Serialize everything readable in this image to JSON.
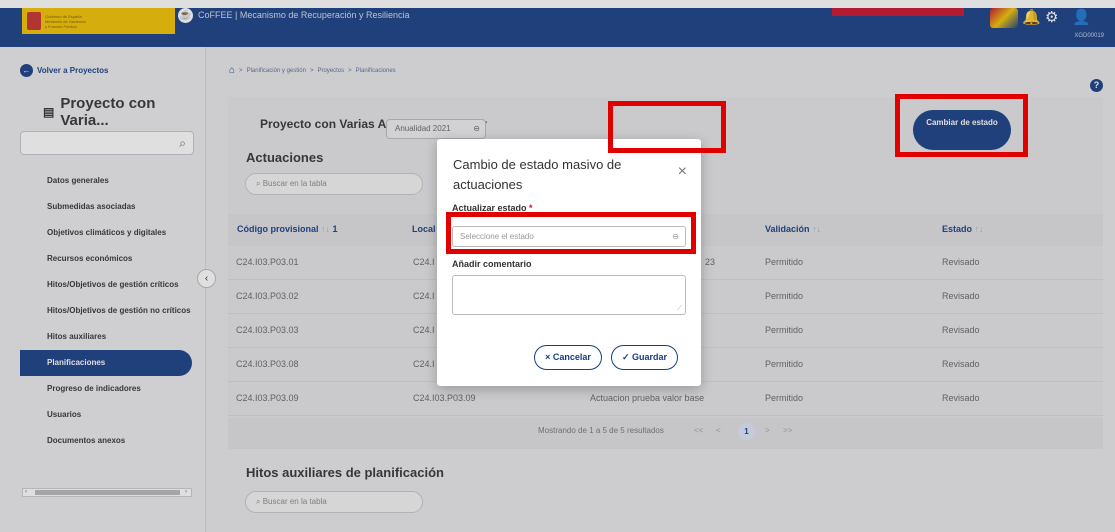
{
  "header": {
    "government_logo_text": [
      "Gobierno de España",
      "Ministerio de Hacienda",
      "y Función Pública"
    ],
    "app_prefix": "CoFFEE",
    "separator": "|",
    "app_title": "Mecanismo de Recuperación y Resiliencia",
    "user_code": "XGD00019",
    "icons": [
      "flag-logo-icon",
      "bell-icon",
      "gear-icon",
      "user-icon"
    ]
  },
  "sidebar": {
    "back_label": "Volver a Proyectos",
    "project_title": "Proyecto con Varia...",
    "search_placeholder": "",
    "items": [
      {
        "label": "Datos generales"
      },
      {
        "label": "Submedidas asociadas"
      },
      {
        "label": "Objetivos climáticos y digitales"
      },
      {
        "label": "Recursos económicos"
      },
      {
        "label": "Hitos/Objetivos de gestión críticos"
      },
      {
        "label": "Hitos/Objetivos de gestión no críticos"
      },
      {
        "label": "Hitos auxiliares"
      },
      {
        "label": "Planificaciones",
        "active": true
      },
      {
        "label": "Progreso de indicadores"
      },
      {
        "label": "Usuarios"
      },
      {
        "label": "Documentos anexos"
      }
    ]
  },
  "breadcrumb": {
    "items": [
      "Planificación y gestión",
      "Proyectos",
      "Planificaciones"
    ],
    "separator": ">"
  },
  "main": {
    "project_title": "Proyecto con Varias Actuaciones Rober",
    "annuality": "Anualidad 2021",
    "change_state_label": "Cambiar de estado",
    "actuaciones_title": "Actuaciones",
    "table_search_placeholder": "Buscar en la tabla",
    "table": {
      "headers": [
        "Código provisional",
        "Local",
        "Validación",
        "Estado"
      ],
      "sort_marker": "1",
      "rows": [
        [
          "C24.I03.P03.01",
          "C24.I",
          "23",
          "Permitido",
          "Revisado"
        ],
        [
          "C24.I03.P03.02",
          "C24.I",
          "",
          "Permitido",
          "Revisado"
        ],
        [
          "C24.I03.P03.03",
          "C24.I",
          "",
          "Permitido",
          "Revisado"
        ],
        [
          "C24.I03.P03.08",
          "C24.I",
          "",
          "Permitido",
          "Revisado"
        ],
        [
          "C24.I03.P03.09",
          "C24.I03.P03.09",
          "Actuacion prueba valor base",
          "Permitido",
          "Revisado"
        ]
      ]
    },
    "pagination": {
      "summary": "Mostrando de 1 a 5 de 5 resultados",
      "current_page": "1",
      "first": "<<",
      "prev": "<",
      "next": ">",
      "last": ">>"
    },
    "hitos_title": "Hitos auxiliares de planificación",
    "hitos_search_placeholder": "Buscar en la tabla"
  },
  "modal": {
    "title": "Cambio de estado masivo de actuaciones",
    "close": "×",
    "state_label": "Actualizar estado",
    "required_mark": "*",
    "state_placeholder": "Seleccione el estado",
    "comment_label": "Añadir comentario",
    "cancel_label": "Cancelar",
    "save_label": "Guardar"
  },
  "colors": {
    "primary": "#173d86",
    "highlight": "#e00000",
    "accent_yellow": "#f3c400"
  }
}
